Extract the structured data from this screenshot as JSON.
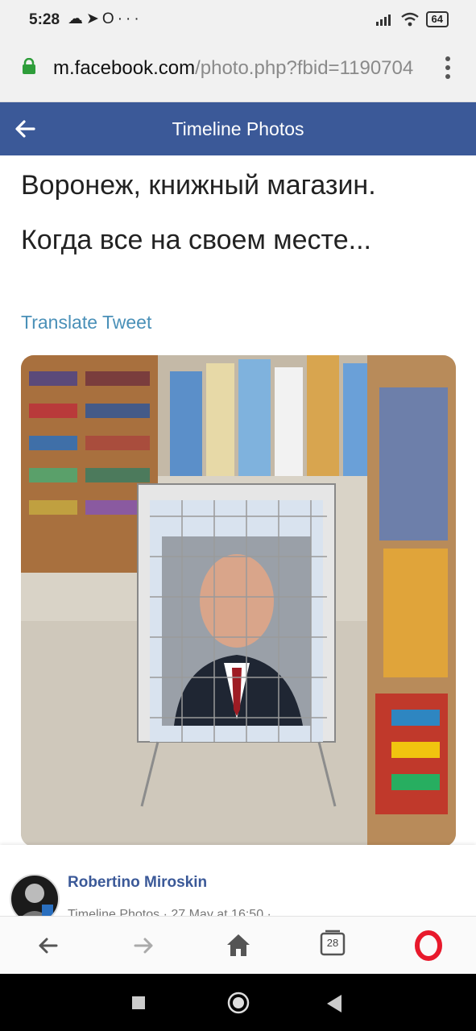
{
  "status": {
    "time": "5:28",
    "battery": "64",
    "icons": [
      "cloud-icon",
      "telegram-icon",
      "opera-status-icon",
      "more-icon"
    ]
  },
  "browser": {
    "domain": "m.facebook.com",
    "path": "/photo.php?fbid=1190704"
  },
  "header": {
    "title": "Timeline Photos"
  },
  "post": {
    "text_line1": "Воронеж, книжный магазин.",
    "text_line2": "Когда все на своем месте...",
    "translate": "Translate Tweet"
  },
  "author": {
    "name": "Robertino Miroskin",
    "meta": "Timeline Photos · 27 May at 16:50 ·"
  },
  "nav": {
    "tab_count": "28"
  },
  "colors": {
    "facebook_blue": "#3b5998",
    "link_blue": "#4a90b8",
    "opera_red": "#e8192c"
  }
}
